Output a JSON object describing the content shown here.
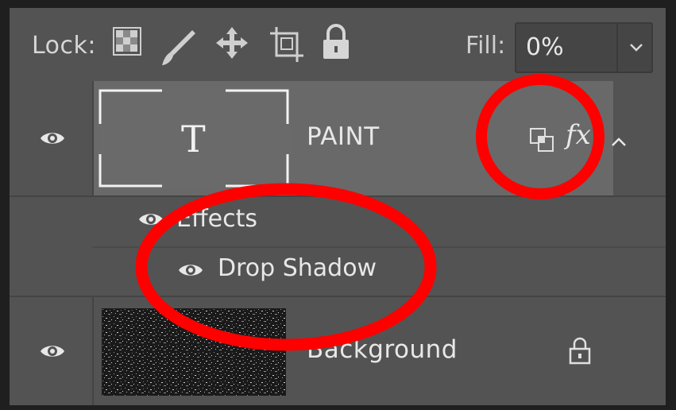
{
  "lock_bar": {
    "label": "Lock:",
    "icons": [
      "transparency-lock-icon",
      "brush-lock-icon",
      "move-lock-icon",
      "artboard-lock-icon",
      "padlock-icon"
    ],
    "fill_label": "Fill:",
    "fill_value": "0%"
  },
  "layers": [
    {
      "name": "PAINT",
      "type": "text",
      "visible": true,
      "selected": true,
      "badges": [
        "linked-style-icon",
        "fx-icon"
      ],
      "fx_text": "fx",
      "thumb_glyph": "T",
      "expanded": true,
      "effects": {
        "label": "Effects",
        "items": [
          {
            "name": "Drop Shadow",
            "visible": true
          }
        ]
      }
    },
    {
      "name": "Background",
      "type": "image",
      "visible": true,
      "locked": true
    }
  ],
  "colors": {
    "panel": "#535353",
    "selected_row": "#696969",
    "annotation": "#ff0000"
  }
}
